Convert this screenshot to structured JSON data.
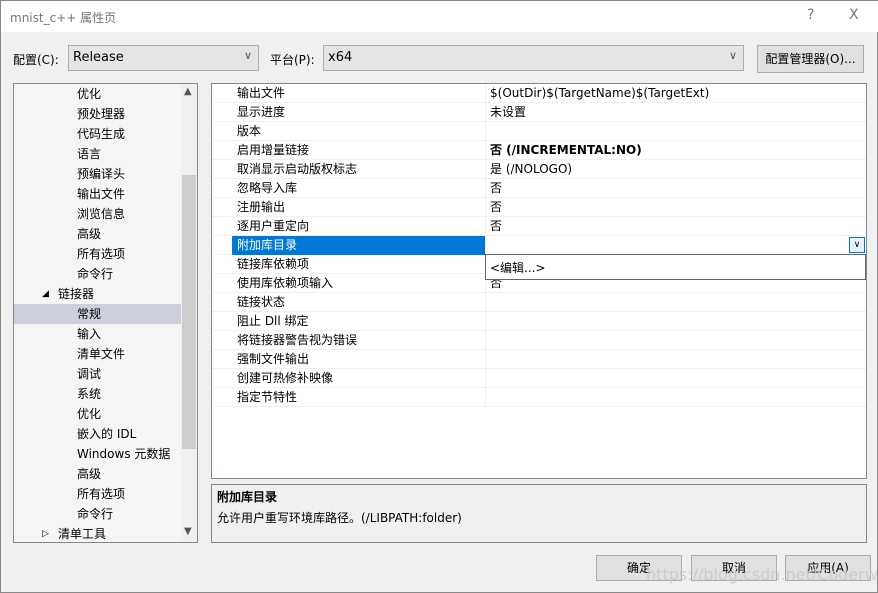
{
  "window": {
    "title": "mnist_c++ 属性页",
    "help": "?",
    "close": "X"
  },
  "config": {
    "label": "配置(C):",
    "value": "Release",
    "platform_label": "平台(P):",
    "platform_value": "x64",
    "manager_button": "配置管理器(O)..."
  },
  "tree": [
    {
      "label": "优化",
      "level": 2
    },
    {
      "label": "预处理器",
      "level": 2
    },
    {
      "label": "代码生成",
      "level": 2
    },
    {
      "label": "语言",
      "level": 2
    },
    {
      "label": "预编译头",
      "level": 2
    },
    {
      "label": "输出文件",
      "level": 2
    },
    {
      "label": "浏览信息",
      "level": 2
    },
    {
      "label": "高级",
      "level": 2
    },
    {
      "label": "所有选项",
      "level": 2
    },
    {
      "label": "命令行",
      "level": 2
    },
    {
      "label": "链接器",
      "level": 1,
      "expanded": true
    },
    {
      "label": "常规",
      "level": 2,
      "selected": true
    },
    {
      "label": "输入",
      "level": 2
    },
    {
      "label": "清单文件",
      "level": 2
    },
    {
      "label": "调试",
      "level": 2
    },
    {
      "label": "系统",
      "level": 2
    },
    {
      "label": "优化",
      "level": 2
    },
    {
      "label": "嵌入的 IDL",
      "level": 2
    },
    {
      "label": "Windows 元数据",
      "level": 2
    },
    {
      "label": "高级",
      "level": 2
    },
    {
      "label": "所有选项",
      "level": 2
    },
    {
      "label": "命令行",
      "level": 2
    },
    {
      "label": "清单工具",
      "level": 1,
      "expanded": false
    }
  ],
  "properties": [
    {
      "name": "输出文件",
      "value": "$(OutDir)$(TargetName)$(TargetExt)"
    },
    {
      "name": "显示进度",
      "value": "未设置"
    },
    {
      "name": "版本",
      "value": ""
    },
    {
      "name": "启用增量链接",
      "value": "否 (/INCREMENTAL:NO)",
      "bold": true
    },
    {
      "name": "取消显示启动版权标志",
      "value": "是 (/NOLOGO)"
    },
    {
      "name": "忽略导入库",
      "value": "否"
    },
    {
      "name": "注册输出",
      "value": "否"
    },
    {
      "name": "逐用户重定向",
      "value": "否"
    },
    {
      "name": "附加库目录",
      "value": "",
      "selected": true
    },
    {
      "name": "链接库依赖项",
      "value": ""
    },
    {
      "name": "使用库依赖项输入",
      "value": "否"
    },
    {
      "name": "链接状态",
      "value": ""
    },
    {
      "name": "阻止 Dll 绑定",
      "value": ""
    },
    {
      "name": "将链接器警告视为错误",
      "value": ""
    },
    {
      "name": "强制文件输出",
      "value": ""
    },
    {
      "name": "创建可热修补映像",
      "value": ""
    },
    {
      "name": "指定节特性",
      "value": ""
    }
  ],
  "dropdown": {
    "option": "<编辑...>"
  },
  "description": {
    "title": "附加库目录",
    "text": "允许用户重写环境库路径。(/LIBPATH:folder)"
  },
  "buttons": {
    "ok": "确定",
    "cancel": "取消",
    "apply": "应用(A)"
  },
  "watermark": "https://blog.csdn.net/Coderwhw"
}
